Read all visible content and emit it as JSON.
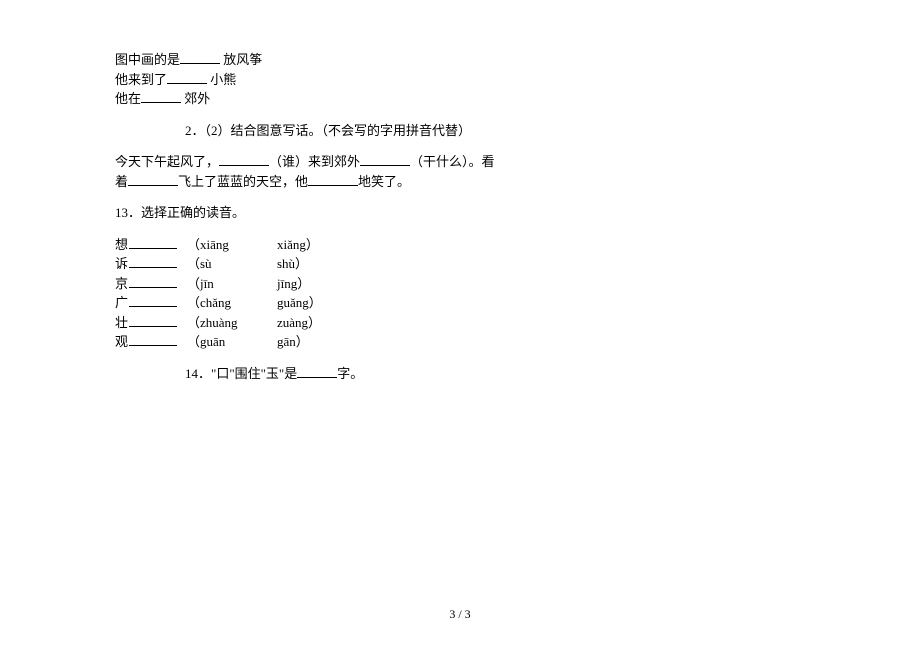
{
  "q1": {
    "line1_prefix": "图中画的是",
    "line1_suffix": " 放风筝",
    "line2_prefix": "他来到了",
    "line2_suffix": " 小熊",
    "line3_prefix": "他在",
    "line3_suffix": " 郊外"
  },
  "q2": {
    "number": "2．",
    "title": "（2）结合图意写话。（不会写的字用拼音代替）",
    "text_p1": "今天下午起风了，",
    "text_p2": "（谁）来到郊外",
    "text_p3": "（干什么）。看",
    "text_line2_p1": "着",
    "text_line2_p2": "飞上了蓝蓝的天空，他",
    "text_line2_p3": "地笑了。"
  },
  "q13": {
    "title": "13．选择正确的读音。",
    "rows": [
      {
        "char": "想",
        "opt1": "（xiāng",
        "opt2": "xiǎng）"
      },
      {
        "char": "诉",
        "opt1": "（sù",
        "opt2": "shù）"
      },
      {
        "char": "京",
        "opt1": "（jīn",
        "opt2": "jīng）"
      },
      {
        "char": "广",
        "opt1": "（chǎng",
        "opt2": "guǎng）"
      },
      {
        "char": "壮",
        "opt1": "（zhuàng",
        "opt2": "zuàng）"
      },
      {
        "char": "观",
        "opt1": "（guān",
        "opt2": "gān）"
      }
    ]
  },
  "q14": {
    "number": "14．",
    "text_p1": "\"口\"围住\"玉\"是",
    "text_p2": "字。"
  },
  "footer": "3 / 3"
}
